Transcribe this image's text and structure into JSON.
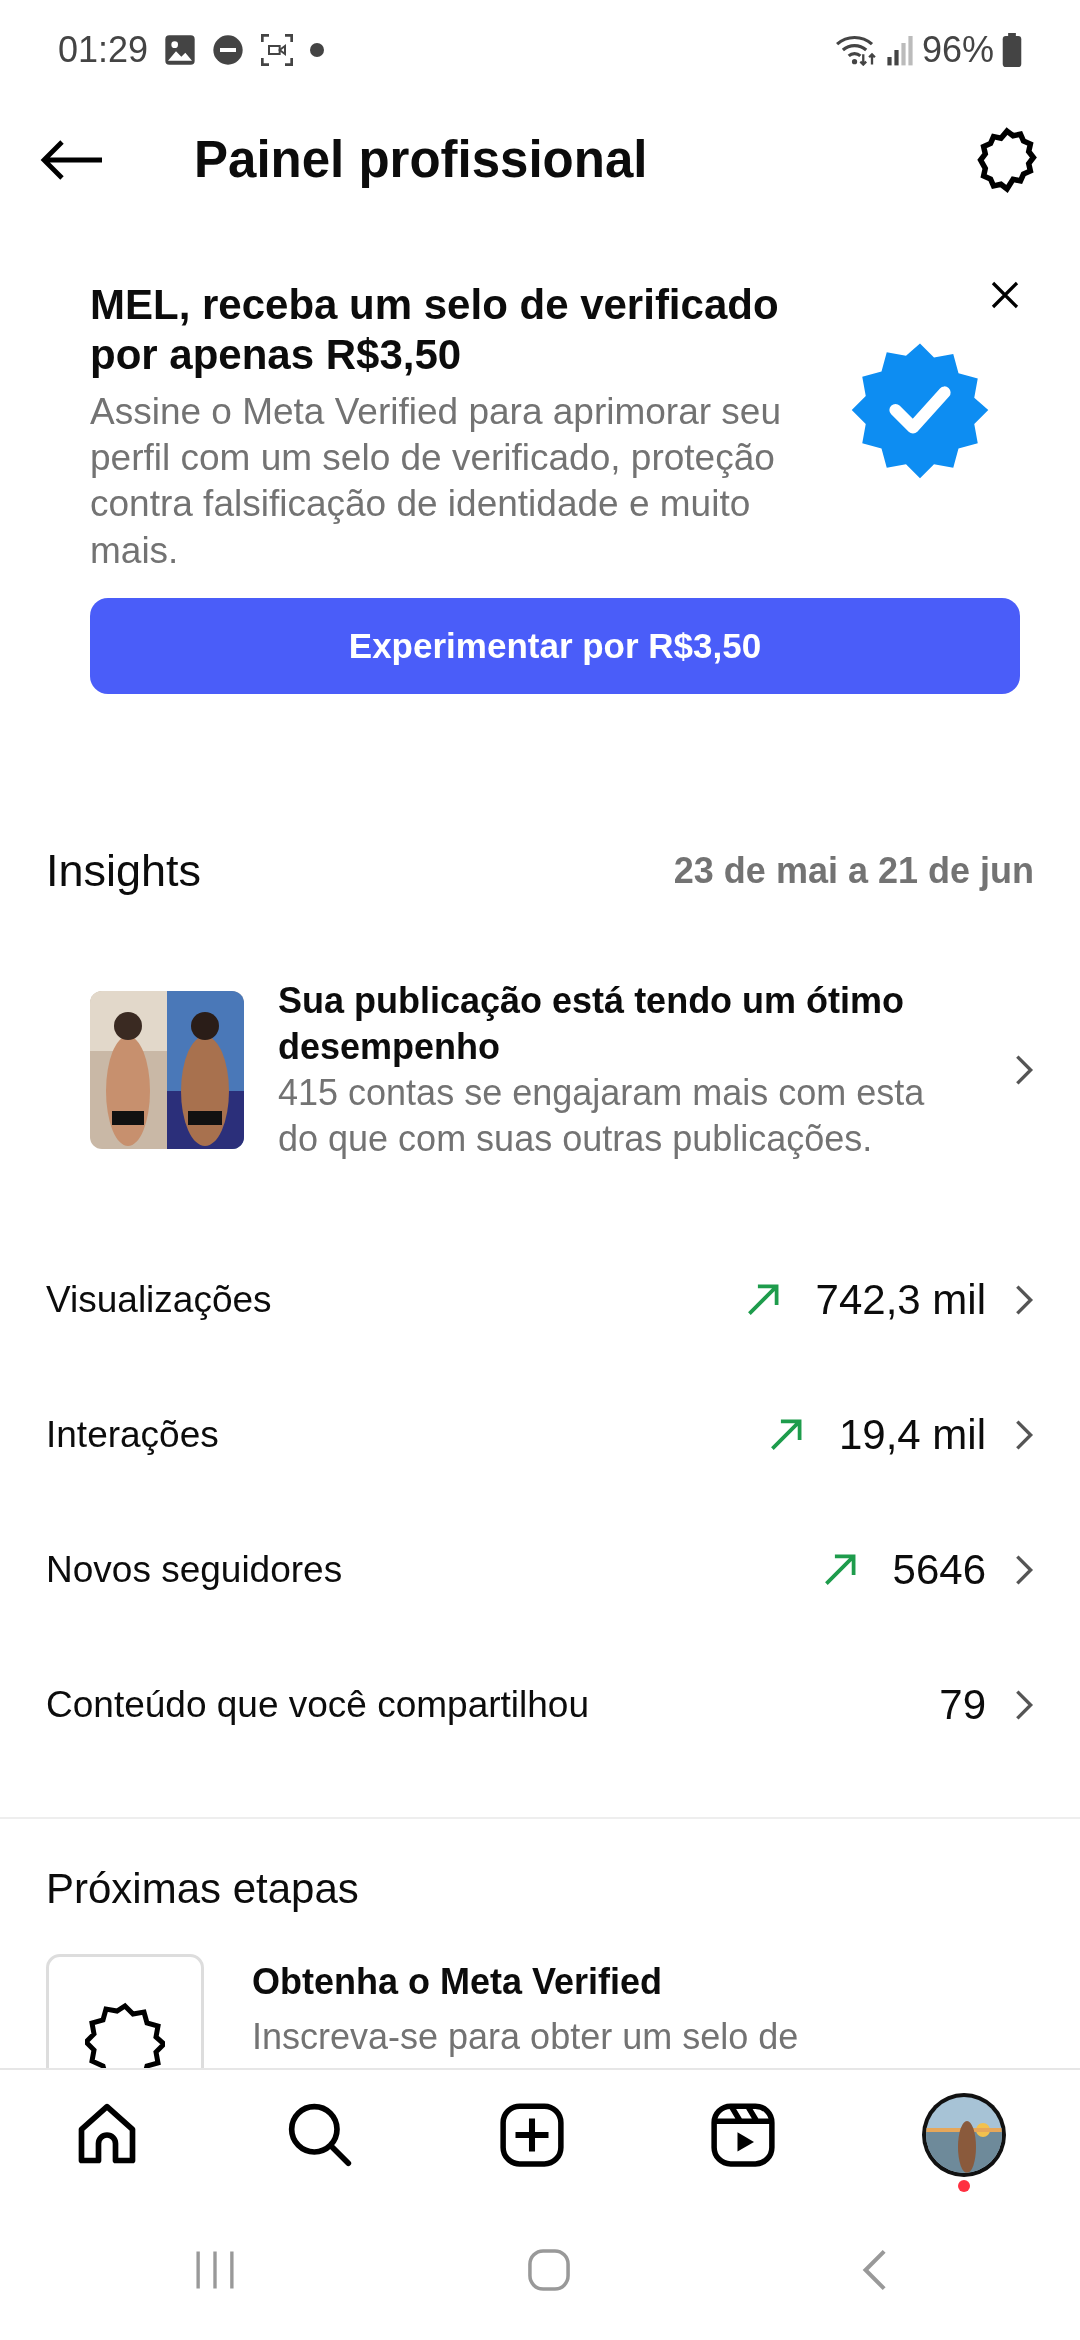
{
  "status_bar": {
    "time": "01:29",
    "battery": "96%"
  },
  "header": {
    "title": "Painel profissional"
  },
  "promo": {
    "title": "MEL, receba um selo de verificado por apenas R$3,50",
    "description": "Assine o Meta Verified para aprimorar seu perfil com um selo de verificado, proteção contra falsificação de identidade e muito mais.",
    "button": "Experimentar por R$3,50"
  },
  "insights": {
    "title": "Insights",
    "date_range": "23 de mai a 21 de jun",
    "post": {
      "kind": "picture",
      "title": "Sua publicação está tendo um ótimo desempenho",
      "description": "415 contas se engajaram mais com esta do que com suas outras publicações."
    },
    "metrics": [
      {
        "label": "Visualizações",
        "value": "742,3 mil",
        "trend_up": true
      },
      {
        "label": "Interações",
        "value": "19,4 mil",
        "trend_up": true
      },
      {
        "label": "Novos seguidores",
        "value": "5646",
        "trend_up": true
      },
      {
        "label": "Conteúdo que você compartilhou",
        "value": "79",
        "trend_up": false
      }
    ]
  },
  "next_steps": {
    "title": "Próximas etapas",
    "items": [
      {
        "title": "Obtenha o Meta Verified",
        "description": "Inscreva-se para obter um selo de"
      }
    ]
  },
  "bottom_nav": {
    "has_notification": true
  }
}
